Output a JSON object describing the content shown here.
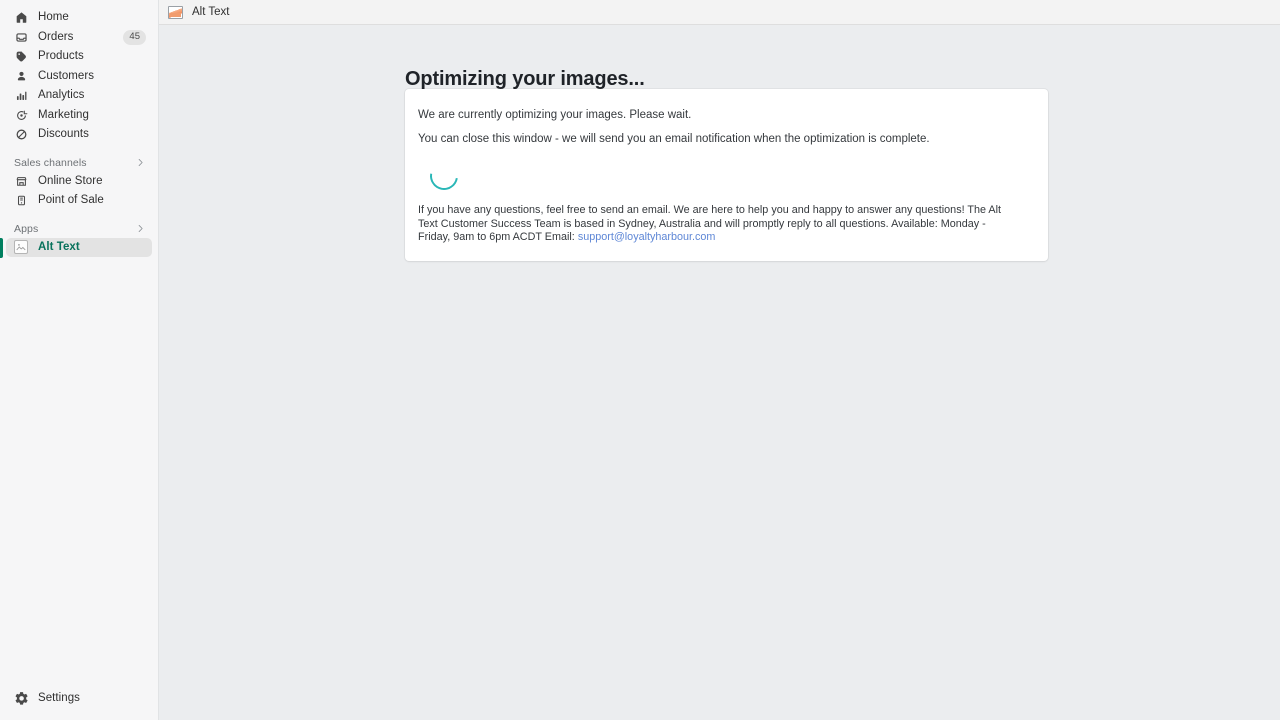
{
  "topbar": {
    "app_icon": "image-app-icon",
    "app_name": "Alt Text"
  },
  "sidebar": {
    "items": [
      {
        "icon": "home-icon",
        "label": "Home"
      },
      {
        "icon": "orders-icon",
        "label": "Orders",
        "badge": "45"
      },
      {
        "icon": "products-icon",
        "label": "Products"
      },
      {
        "icon": "customers-icon",
        "label": "Customers"
      },
      {
        "icon": "analytics-icon",
        "label": "Analytics"
      },
      {
        "icon": "marketing-icon",
        "label": "Marketing"
      },
      {
        "icon": "discounts-icon",
        "label": "Discounts"
      }
    ],
    "sales_channels": {
      "label": "Sales channels",
      "chevron": "chevron-right-icon",
      "items": [
        {
          "icon": "online-store-icon",
          "label": "Online Store"
        },
        {
          "icon": "point-of-sale-icon",
          "label": "Point of Sale"
        }
      ]
    },
    "apps": {
      "label": "Apps",
      "chevron": "chevron-right-icon",
      "items": [
        {
          "icon": "app-icon",
          "label": "Alt Text",
          "selected": true
        }
      ]
    },
    "settings": {
      "icon": "gear-icon",
      "label": "Settings"
    },
    "colors": {
      "background": "#f6f6f7",
      "selected_background": "#e3e3e3",
      "selected_accent": "#007f5f",
      "selected_text": "#08725c",
      "label_text": "#303030",
      "section_text": "#6d7175"
    }
  },
  "main": {
    "page_title": "Optimizing your images...",
    "card": {
      "line1": "We are currently optimizing your images. Please wait.",
      "line2": "You can close this window - we will send you an email notification when the optimization is complete.",
      "spinner": {
        "name": "loading-spinner",
        "color": "#2ab7b7"
      },
      "help_text": "If you have any questions, feel free to send an email. We are here to help you and happy to answer any questions! The Alt Text Customer Success Team is based in Sydney, Australia and will promptly reply to all questions. Available: Monday - Friday, 9am to 6pm ACDT Email:",
      "support_email": "support@loyaltyharbour.com",
      "link_color": "#5e87d6"
    },
    "background": "#ebedef",
    "card_background": "#ffffff"
  }
}
